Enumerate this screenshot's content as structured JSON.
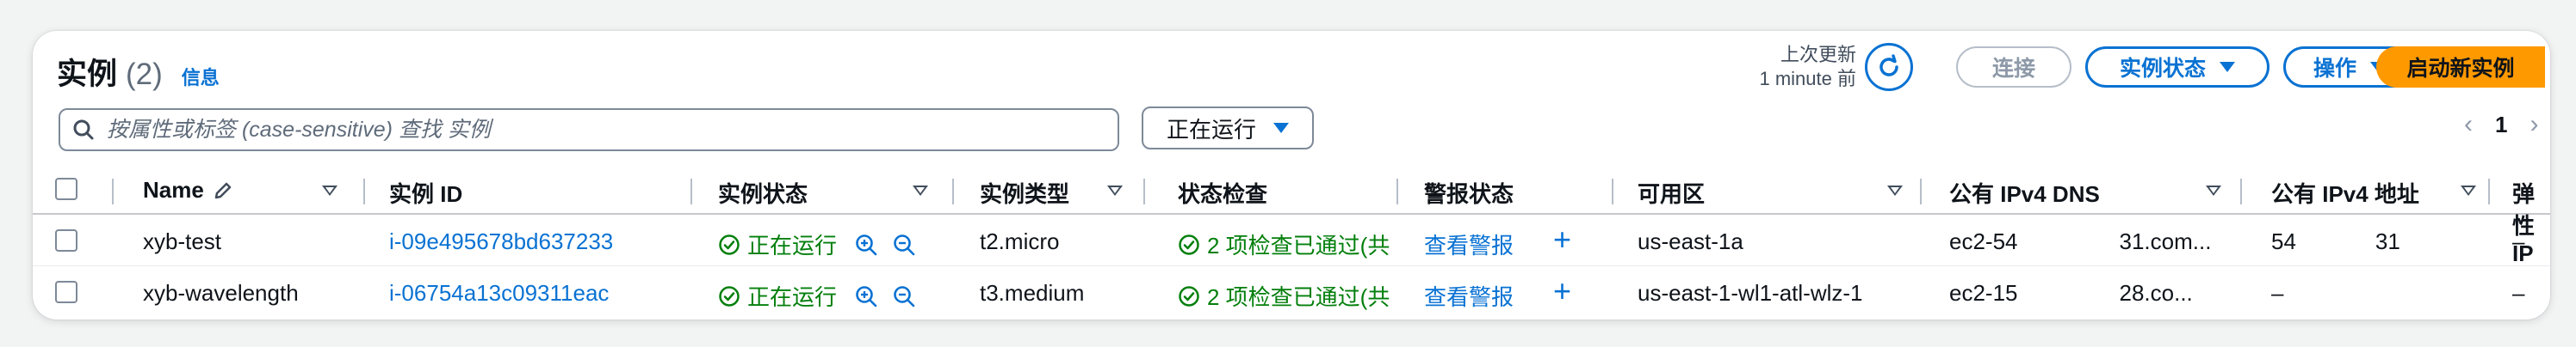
{
  "header": {
    "title": "实例",
    "count": "(2)",
    "info_link": "信息",
    "last_updated_label": "上次更新",
    "last_updated_value": "1 minute 前"
  },
  "toolbar": {
    "connect_label": "连接",
    "instance_state_label": "实例状态",
    "actions_label": "操作",
    "launch_label": "启动新实例"
  },
  "search": {
    "placeholder": "按属性或标签 (case-sensitive) 查找 实例"
  },
  "filter": {
    "value": "正在运行"
  },
  "pagination": {
    "current_page": "1"
  },
  "table": {
    "columns": [
      "Name",
      "实例 ID",
      "实例状态",
      "实例类型",
      "状态检查",
      "警报状态",
      "可用区",
      "公有 IPv4 DNS",
      "公有 IPv4 地址",
      "弹性 IP"
    ],
    "rows": [
      {
        "name": "xyb-test",
        "instance_id": "i-09e495678bd637233",
        "state": "正在运行",
        "type": "t2.micro",
        "status_check": "2 项检查已通过(共",
        "alarm": "查看警报",
        "az": "us-east-1a",
        "dns_start": "ec2-54",
        "dns_end": "31.com...",
        "ip_start": "54",
        "ip_end": "31",
        "eip": "–"
      },
      {
        "name": "xyb-wavelength",
        "instance_id": "i-06754a13c09311eac",
        "state": "正在运行",
        "type": "t3.medium",
        "status_check": "2 项检查已通过(共",
        "alarm": "查看警报",
        "az": "us-east-1-wl1-atl-wlz-1",
        "dns_start": "ec2-15",
        "dns_end": "28.co...",
        "ip_start": "–",
        "ip_end": "",
        "eip": "–"
      }
    ]
  },
  "colors": {
    "link": "#0972d3",
    "success": "#037f0c",
    "primary_button": "#ff9900"
  }
}
